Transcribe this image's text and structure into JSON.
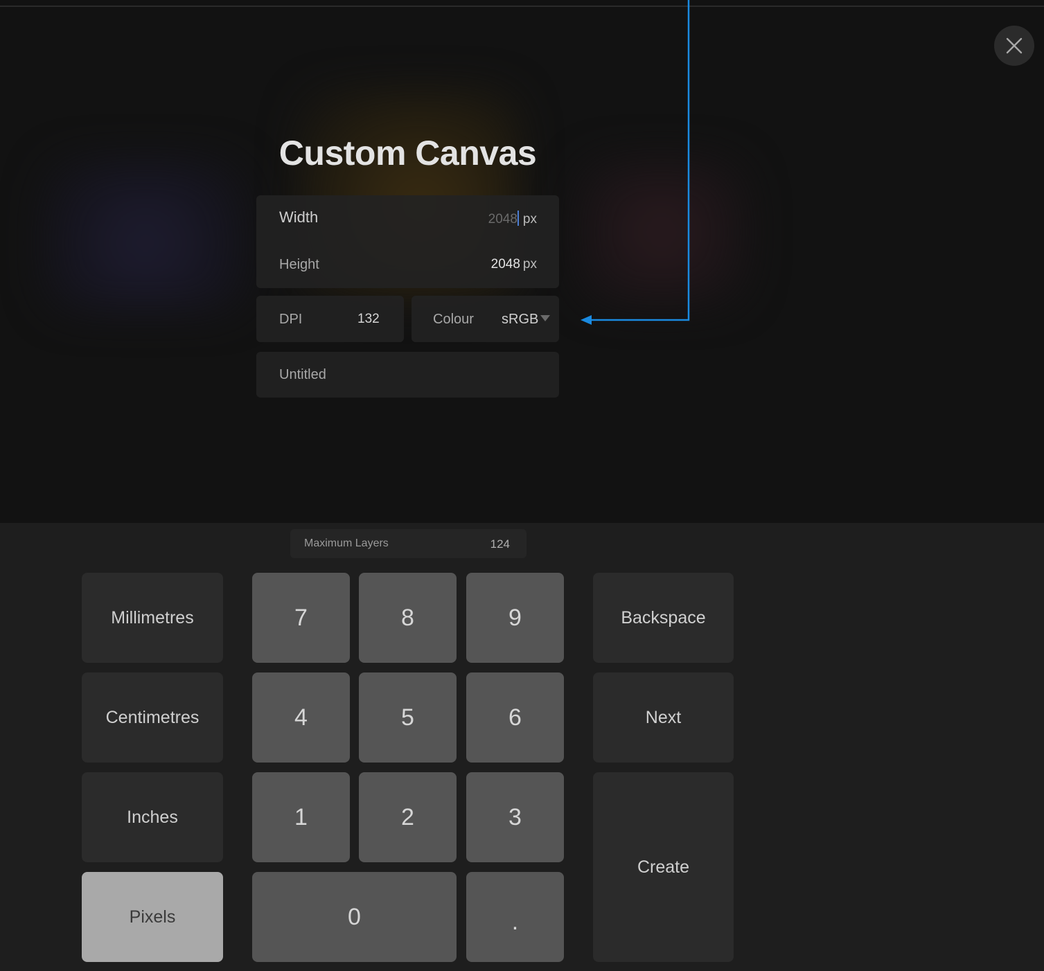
{
  "dialog": {
    "title": "Custom Canvas",
    "close_icon": "close-icon"
  },
  "fields": {
    "width": {
      "label": "Width",
      "value": "2048",
      "unit": "px"
    },
    "height": {
      "label": "Height",
      "value": "2048",
      "unit": "px"
    },
    "dpi": {
      "label": "DPI",
      "value": "132"
    },
    "colour": {
      "label": "Colour",
      "value": "sRGB",
      "icon": "dropdown-triangle-icon"
    },
    "name": {
      "value": "Untitled"
    }
  },
  "max_layers": {
    "label": "Maximum Layers",
    "value": "124"
  },
  "units": {
    "millimetres": "Millimetres",
    "centimetres": "Centimetres",
    "inches": "Inches",
    "pixels": "Pixels",
    "selected": "Pixels"
  },
  "keypad": {
    "k7": "7",
    "k8": "8",
    "k9": "9",
    "k4": "4",
    "k5": "5",
    "k6": "6",
    "k1": "1",
    "k2": "2",
    "k3": "3",
    "k0": "0",
    "dot": "."
  },
  "actions": {
    "backspace": "Backspace",
    "next": "Next",
    "create": "Create"
  },
  "colors": {
    "annotation_arrow": "#1a8ae0",
    "cursor": "#4c7fd6",
    "active_unit": "#a9a9a9"
  }
}
